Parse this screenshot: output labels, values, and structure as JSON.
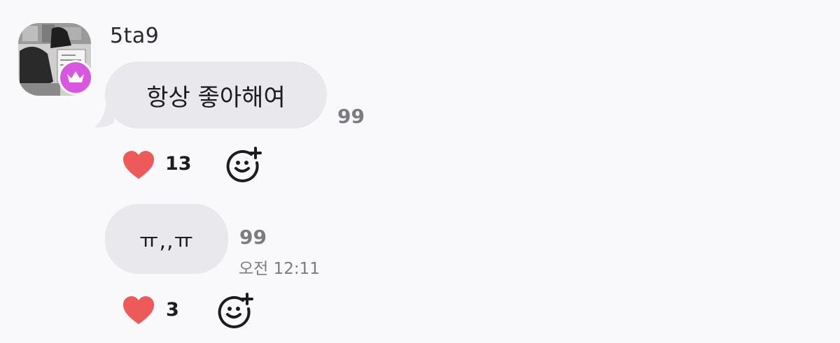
{
  "messages": [
    {
      "username": "5ta9",
      "text": "항상 좋아해여",
      "read_count": "99",
      "likes": "13"
    },
    {
      "text": "ㅠ,,ㅠ",
      "read_count": "99",
      "timestamp": "오전 12:11",
      "likes": "3"
    }
  ],
  "colors": {
    "background": "#f9f9fb",
    "bubble": "#e8e8ed",
    "heart": "#ee5a5a",
    "crown_badge": "#d957e0",
    "muted_text": "#7b7b80"
  },
  "icons": {
    "like": "heart-icon",
    "badge": "crown-icon",
    "add_reaction": "add-emoji-reaction-icon"
  }
}
